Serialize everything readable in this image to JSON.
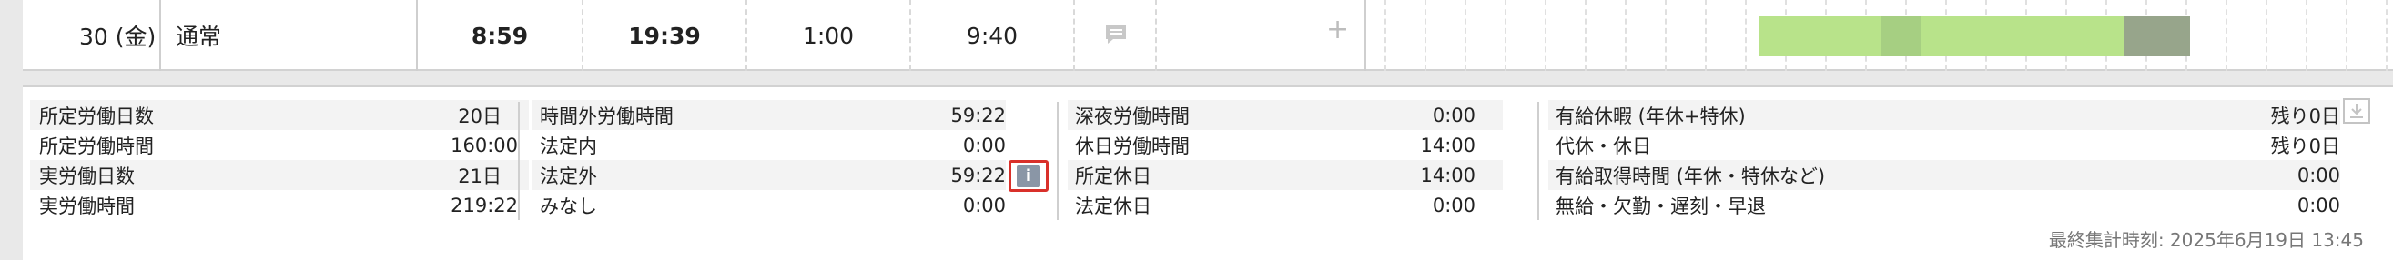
{
  "row": {
    "date": "30 (金)",
    "type": "通常",
    "start": "8:59",
    "end": "19:39",
    "break": "1:00",
    "work": "9:40",
    "comment_icon": "comment-icon",
    "add_icon": "+",
    "timeline_colors": {
      "light": "#b8e38a",
      "mid": "#a6cf82",
      "dark": "#97a58b"
    }
  },
  "summary": {
    "col1": [
      {
        "label": "所定労働日数",
        "value": "20日"
      },
      {
        "label": "所定労働時間",
        "value": "160:00"
      },
      {
        "label": "実労働日数",
        "value": "21日"
      },
      {
        "label": "実労働時間",
        "value": "219:22"
      }
    ],
    "col2": [
      {
        "label": "時間外労働時間",
        "value": "59:22"
      },
      {
        "label": "法定内",
        "value": "0:00"
      },
      {
        "label": "法定外",
        "value": "59:22"
      },
      {
        "label": "みなし",
        "value": "0:00"
      }
    ],
    "col3": [
      {
        "label": "深夜労働時間",
        "value": "0:00"
      },
      {
        "label": "休日労働時間",
        "value": "14:00"
      },
      {
        "label": "所定休日",
        "value": "14:00"
      },
      {
        "label": "法定休日",
        "value": "0:00"
      }
    ],
    "col4": [
      {
        "label": "有給休暇 (年休+特休)",
        "value": "残り0日"
      },
      {
        "label": "代休・休日",
        "value": "残り0日"
      },
      {
        "label": "有給取得時間 (年休・特休など)",
        "value": "0:00"
      },
      {
        "label": "無給・欠勤・遅刻・早退",
        "value": "0:00"
      }
    ],
    "info_icon": "i",
    "last_aggregated": "最終集計時刻: 2025年6月19日 13:45"
  }
}
